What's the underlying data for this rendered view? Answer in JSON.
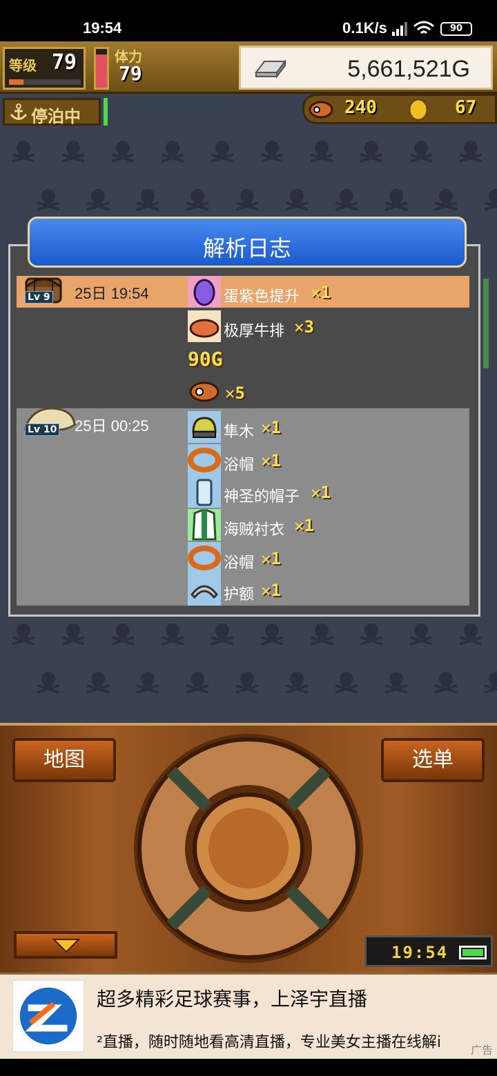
{
  "status_bar": {
    "time": "19:54",
    "network_speed": "0.1K/s",
    "battery": "90"
  },
  "hud": {
    "level_label": "等级",
    "level_value": "79",
    "level_progress": 0.2,
    "stamina_label": "体力",
    "stamina_value": "79",
    "stamina_fill": 0.85,
    "gold": "5,661,521G",
    "dock_status": "停泊中",
    "resource_a": "240",
    "resource_b": "67"
  },
  "log": {
    "title": "解析日志",
    "entries": [
      {
        "level": "Lv 9",
        "time": "25日 19:54",
        "items": [
          {
            "name": "蛋紫色提升",
            "qty": "✕1",
            "icon": "purple-egg-icon"
          },
          {
            "name": "极厚牛排",
            "qty": "✕3",
            "icon": "steak-icon"
          },
          {
            "name": "",
            "qty": "90G",
            "icon": "gold-icon"
          },
          {
            "name": "",
            "qty": "✕5",
            "icon": "fish-icon"
          }
        ]
      },
      {
        "level": "Lv 10",
        "time": "25日 00:25",
        "items": [
          {
            "name": "隼木",
            "qty": "✕1",
            "icon": "helmet-icon"
          },
          {
            "name": "浴帽",
            "qty": "✕1",
            "icon": "ring-icon"
          },
          {
            "name": "神圣的帽子",
            "qty": "✕1",
            "icon": "jar-icon"
          },
          {
            "name": "海贼衬衣",
            "qty": "✕1",
            "icon": "shirt-icon"
          },
          {
            "name": "浴帽",
            "qty": "✕1",
            "icon": "ring-icon"
          },
          {
            "name": "护额",
            "qty": "✕1",
            "icon": "headband-icon"
          }
        ]
      }
    ]
  },
  "controls": {
    "map_button": "地图",
    "menu_button": "选单",
    "clock": "19:54"
  },
  "ad": {
    "title": "超多精彩足球赛事，上泽宇直播",
    "body": "²直播，随时随地看高清直播，专业美女主播在线解i",
    "tag": "广告"
  }
}
